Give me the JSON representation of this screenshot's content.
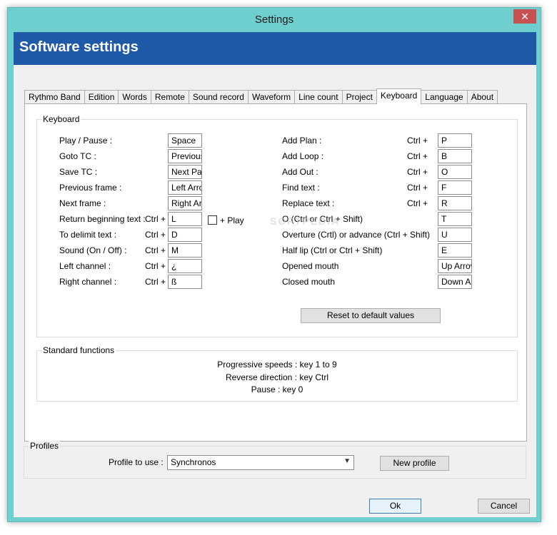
{
  "window": {
    "title": "Settings",
    "close_glyph": "✕"
  },
  "banner": {
    "title": "Software settings"
  },
  "tabs": [
    "Rythmo Band",
    "Edition",
    "Words",
    "Remote",
    "Sound record",
    "Waveform",
    "Line count",
    "Project",
    "Keyboard",
    "Language",
    "About"
  ],
  "active_tab": "Keyboard",
  "keyboard": {
    "group_title": "Keyboard",
    "left": [
      {
        "label": "Play / Pause :",
        "modifier": "",
        "value": "Space"
      },
      {
        "label": "Goto TC :",
        "modifier": "",
        "value": "Previous"
      },
      {
        "label": "Save TC :",
        "modifier": "",
        "value": "Next Pag"
      },
      {
        "label": "Previous frame :",
        "modifier": "",
        "value": "Left Arro"
      },
      {
        "label": "Next frame :",
        "modifier": "",
        "value": "Right Ar"
      },
      {
        "label": "Return beginning text :",
        "modifier": "Ctrl +",
        "value": "L"
      },
      {
        "label": "To delimit text :",
        "modifier": "Ctrl +",
        "value": "D"
      },
      {
        "label": "Sound (On / Off) :",
        "modifier": "Ctrl +",
        "value": "M"
      },
      {
        "label": "Left channel :",
        "modifier": "Ctrl +",
        "value": "¿"
      },
      {
        "label": "Right channel :",
        "modifier": "Ctrl +",
        "value": "ß"
      }
    ],
    "play_checkbox_label": "+ Play",
    "right": [
      {
        "label": "Add Plan :",
        "modifier": "Ctrl +",
        "value": "P"
      },
      {
        "label": "Add Loop :",
        "modifier": "Ctrl +",
        "value": "B"
      },
      {
        "label": "Add Out :",
        "modifier": "Ctrl +",
        "value": "O"
      },
      {
        "label": "Find text :",
        "modifier": "Ctrl +",
        "value": "F"
      },
      {
        "label": "Replace text :",
        "modifier": "Ctrl +",
        "value": "R"
      },
      {
        "label": "O (Ctrl or Ctrl + Shift)",
        "modifier": "",
        "value": "T"
      },
      {
        "label": "Overture (Crtl) or advance (Ctrl + Shift)",
        "modifier": "",
        "value": "U"
      },
      {
        "label": "Half lip (Ctrl or Ctrl + Shift)",
        "modifier": "",
        "value": "E"
      },
      {
        "label": "Opened mouth",
        "modifier": "",
        "value": "Up Arrov"
      },
      {
        "label": "Closed mouth",
        "modifier": "",
        "value": "Down Ar"
      }
    ],
    "reset_button": "Reset to default values"
  },
  "standard_functions": {
    "group_title": "Standard functions",
    "lines": [
      "Progressive speeds : key 1 to 9",
      "Reverse direction : key Ctrl",
      "Pause : key 0"
    ]
  },
  "profiles": {
    "group_title": "Profiles",
    "label": "Profile to use :",
    "selected": "Synchronos",
    "new_button": "New profile"
  },
  "footer": {
    "ok": "Ok",
    "cancel": "Cancel"
  },
  "watermark": "SOFTPEDIA",
  "colors": {
    "window_frame": "#6fcfcf",
    "banner": "#1e5aa8",
    "close": "#c75050"
  }
}
